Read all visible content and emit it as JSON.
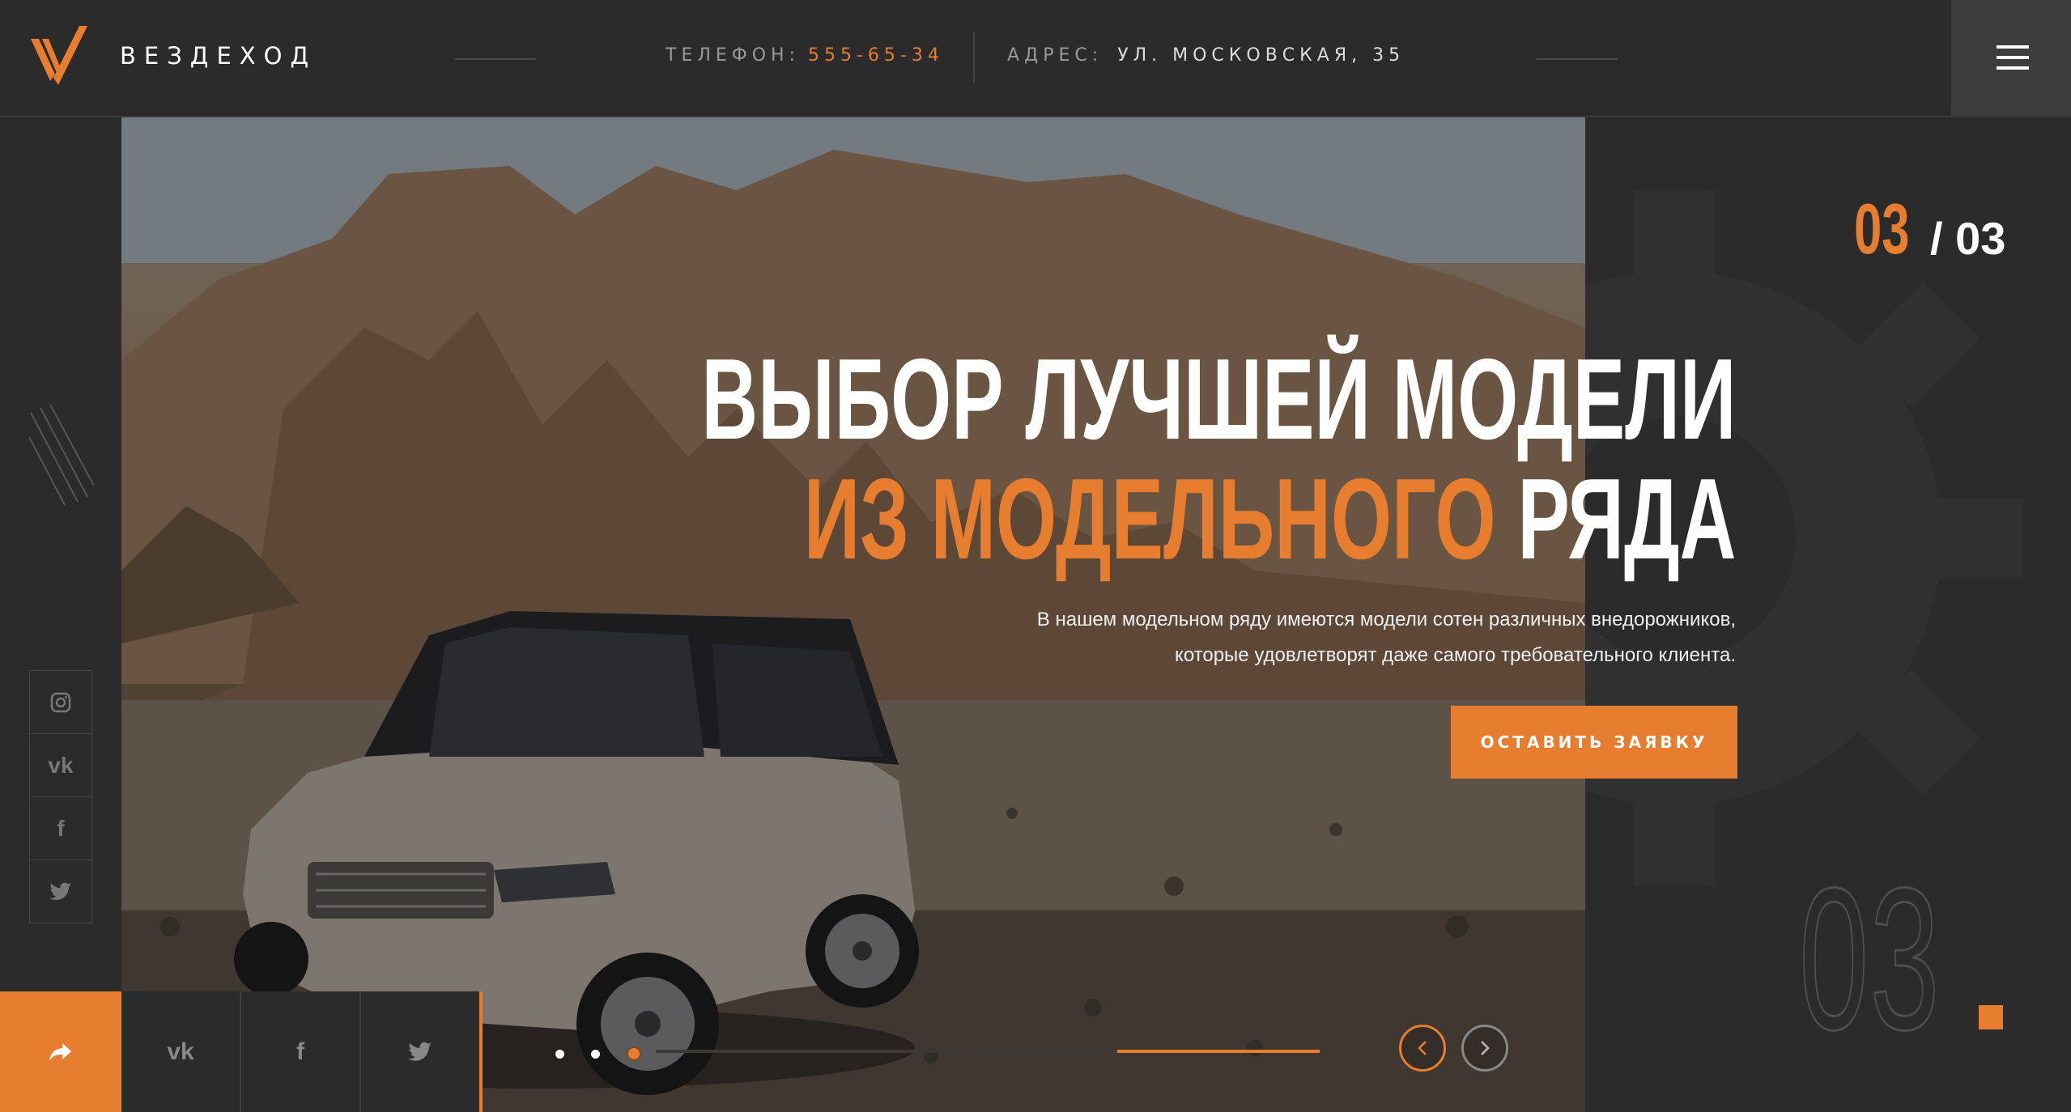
{
  "header": {
    "brand": "ВЕЗДЕХОД",
    "phone_label": "ТЕЛЕФОН:",
    "phone_value": "555-65-34",
    "address_label": "АДРЕС:",
    "address_value": "УЛ. МОСКОВСКАЯ, 35",
    "menu_icon": "hamburger-icon"
  },
  "sidebar": {
    "social": [
      {
        "name": "instagram",
        "glyph": "◎"
      },
      {
        "name": "vk",
        "glyph": "vk"
      },
      {
        "name": "facebook",
        "glyph": "f"
      },
      {
        "name": "twitter",
        "glyph": "🐦"
      }
    ]
  },
  "slide": {
    "current": "03",
    "total_text": "/ 03",
    "title_line1": "ВЫБОР ЛУЧШЕЙ МОДЕЛИ",
    "title_line2_accent": "ИЗ МОДЕЛЬНОГО",
    "title_line2_rest": " РЯДА",
    "description_line1": "В нашем модельном ряду имеются модели сотен различных внедорожников,",
    "description_line2": "которые удовлетворят даже самого требовательного клиента.",
    "cta_label": "ОСТАВИТЬ ЗАЯВКУ",
    "big_number": "03",
    "progress": 0.3
  },
  "footer": {
    "share_icon": "share-icon",
    "social": [
      "vk",
      "f",
      "t"
    ]
  },
  "colors": {
    "accent": "#e77d2f",
    "background": "#2b2b2b"
  }
}
